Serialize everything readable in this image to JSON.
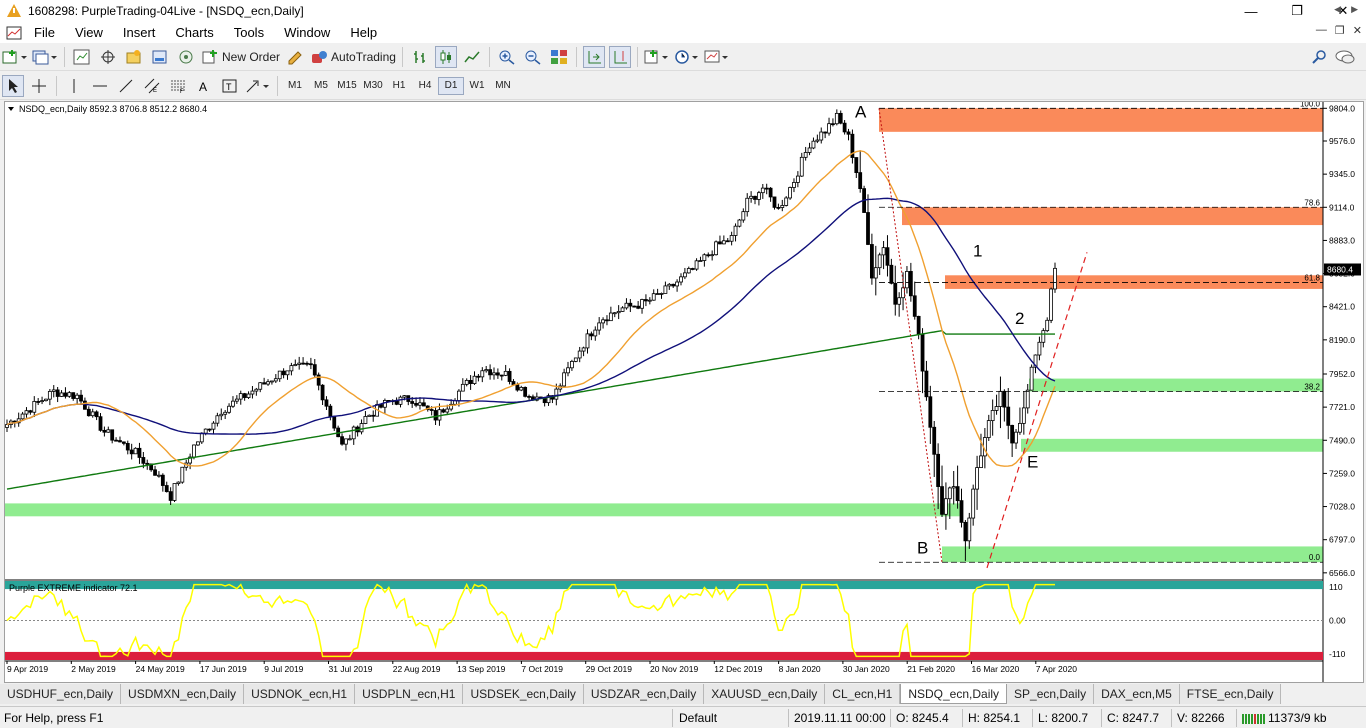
{
  "window": {
    "title": "1608298: PurpleTrading-04Live - [NSDQ_ecn,Daily]"
  },
  "menu": [
    "File",
    "View",
    "Insert",
    "Charts",
    "Tools",
    "Window",
    "Help"
  ],
  "toolbar": {
    "new_order": "New Order",
    "auto_trading": "AutoTrading"
  },
  "timeframes": [
    "M1",
    "M5",
    "M15",
    "M30",
    "H1",
    "H4",
    "D1",
    "W1",
    "MN"
  ],
  "active_timeframe": "D1",
  "chart_header": {
    "symbol": "NSDQ_ecn,Daily",
    "ohlc": "8592.3 8706.8 8512.2 8680.4"
  },
  "chart_data": {
    "type": "candlestick",
    "price_axis": {
      "ticks": [
        "9804.0",
        "9576.0",
        "9345.0",
        "9114.0",
        "8883.0",
        "8652.0",
        "8421.0",
        "8190.0",
        "7952.0",
        "7721.0",
        "7490.0",
        "7259.0",
        "7028.0",
        "6797.0",
        "6566.0"
      ],
      "current": "8680.4",
      "range": [
        6530,
        9820
      ]
    },
    "date_axis": [
      "9 Apr 2019",
      "2 May 2019",
      "24 May 2019",
      "17 Jun 2019",
      "9 Jul 2019",
      "31 Jul 2019",
      "22 Aug 2019",
      "13 Sep 2019",
      "7 Oct 2019",
      "29 Oct 2019",
      "20 Nov 2019",
      "12 Dec 2019",
      "8 Jan 2020",
      "30 Jan 2020",
      "21 Feb 2020",
      "16 Mar 2020",
      "7 Apr 2020"
    ],
    "fib_levels": [
      {
        "label": "100.0",
        "price": 9804
      },
      {
        "label": "78.6",
        "price": 9114
      },
      {
        "label": "61.8",
        "price": 8590
      },
      {
        "label": "38.2",
        "price": 7830
      },
      {
        "label": "0.0",
        "price": 6640
      }
    ],
    "zones": [
      {
        "type": "resistance",
        "color": "#fa8a5a",
        "from": 9640,
        "to": 9804
      },
      {
        "type": "resistance",
        "color": "#fa8a5a",
        "from": 8990,
        "to": 9114
      },
      {
        "type": "resistance",
        "color": "#fa8a5a",
        "from": 8545,
        "to": 8640
      },
      {
        "type": "support",
        "color": "#90ec90",
        "from": 7830,
        "to": 7920
      },
      {
        "type": "support",
        "color": "#90ec90",
        "from": 7410,
        "to": 7500
      },
      {
        "type": "support",
        "color": "#90ec90",
        "from": 6960,
        "to": 7050
      },
      {
        "type": "support",
        "color": "#90ec90",
        "from": 6640,
        "to": 6750
      }
    ],
    "labels": [
      "A",
      "B",
      "1",
      "2",
      "E"
    ],
    "indicator": {
      "name": "Purple EXTREME indicator 72.1",
      "levels": [
        "110",
        "0.00",
        "-110"
      ]
    }
  },
  "tabs": [
    "USDHUF_ecn,Daily",
    "USDMXN_ecn,Daily",
    "USDNOK_ecn,H1",
    "USDPLN_ecn,H1",
    "USDSEK_ecn,Daily",
    "USDZAR_ecn,Daily",
    "XAUUSD_ecn,Daily",
    "CL_ecn,H1",
    "NSDQ_ecn,Daily",
    "SP_ecn,Daily",
    "DAX_ecn,M5",
    "FTSE_ecn,Daily"
  ],
  "active_tab": "NSDQ_ecn,Daily",
  "status": {
    "help": "For Help, press F1",
    "profile": "Default",
    "datetime": "2019.11.11 00:00",
    "open": "O: 8245.4",
    "high": "H: 8254.1",
    "low": "L: 8200.7",
    "close": "C: 8247.7",
    "volume": "V: 82266",
    "traffic": "11373/9 kb"
  },
  "colors": {
    "bull_candle": "#000000",
    "ma_fast": "#f0a030",
    "ma_mid": "#10107a",
    "ma_slow": "#107a10",
    "indicator_line": "#ffff00",
    "indicator_top": "#2aa59a",
    "indicator_bottom": "#dc1e3c"
  }
}
